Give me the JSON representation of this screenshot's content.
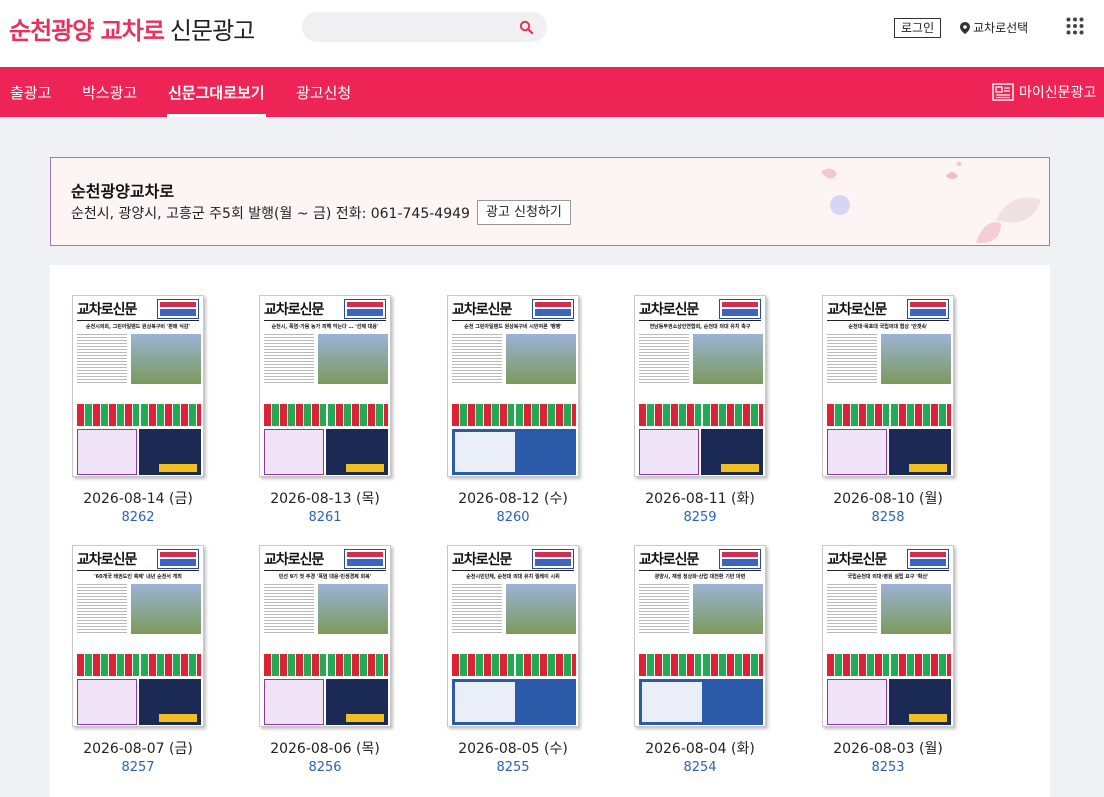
{
  "header": {
    "logo_brand": "순천광양 교차로",
    "logo_sub": "신문광고",
    "search_placeholder": "",
    "login_label": "로그인",
    "station_label": "교차로선택"
  },
  "nav": {
    "items": [
      "출광고",
      "박스광고",
      "신문그대로보기",
      "광고신청"
    ],
    "active_index": 2,
    "my_ad_label": "마이신문광고"
  },
  "banner": {
    "title": "순천광양교차로",
    "info": "순천시, 광양시, 고흥군 주5회 발행(월 ~ 금) 전화: 061-745-4949",
    "apply_label": "광고 신청하기"
  },
  "issues": [
    {
      "date": "2026-08-14 (금)",
      "number": "8262"
    },
    {
      "date": "2026-08-13 (목)",
      "number": "8261"
    },
    {
      "date": "2026-08-12 (수)",
      "number": "8260"
    },
    {
      "date": "2026-08-11 (화)",
      "number": "8259"
    },
    {
      "date": "2026-08-10 (월)",
      "number": "8258"
    },
    {
      "date": "2026-08-07 (금)",
      "number": "8257"
    },
    {
      "date": "2026-08-06 (목)",
      "number": "8256"
    },
    {
      "date": "2026-08-05 (수)",
      "number": "8255"
    },
    {
      "date": "2026-08-04 (화)",
      "number": "8254"
    },
    {
      "date": "2026-08-03 (월)",
      "number": "8253"
    }
  ],
  "newspaper_masthead": "교차로신문",
  "headlines": [
    "순천시의회, 그린아일랜드 원상복구비 '판매 식감'",
    "순천시, 폭염·가뭄 농가 피해 막는다 … '선제 대응'",
    "순천 그린아일랜드 원상복구비 시민여론 '팽팽'",
    "전남동부권소상인연합회, 순천대 의대 유치 촉구",
    "순천대·목포대 국립의대 협상 '안갯속'",
    "'60개국 태권도인 축제' 내년 순천서 개최",
    "민선 9기 첫 추경 '폭염 대응·민생경제 회복'",
    "순천시민단체, 순천대 의대 유치 릴레이 시위",
    "광양시, 재생 청상화·산업 대전환 기반 마련",
    "국립순천대 의대·병원 설립 요구 '확산'"
  ],
  "colors": {
    "brand": "#ee2456",
    "link": "#2b62b8"
  }
}
